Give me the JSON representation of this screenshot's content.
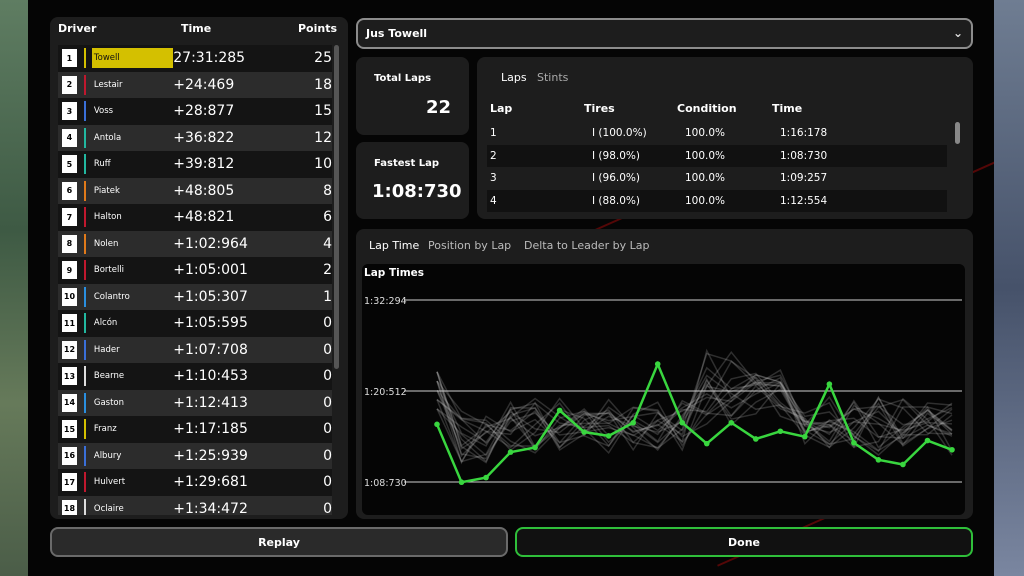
{
  "standings": {
    "headers": {
      "driver": "Driver",
      "time": "Time",
      "points": "Points"
    },
    "rows": [
      {
        "pos": "1",
        "name": "Towell",
        "time": "27:31:285",
        "points": "25",
        "color": "#d4c000",
        "highlight": true
      },
      {
        "pos": "2",
        "name": "Lestair",
        "time": "+24:469",
        "points": "18",
        "color": "#c0182e"
      },
      {
        "pos": "3",
        "name": "Voss",
        "time": "+28:877",
        "points": "15",
        "color": "#3a6fd8"
      },
      {
        "pos": "4",
        "name": "Antola",
        "time": "+36:822",
        "points": "12",
        "color": "#22b8a0"
      },
      {
        "pos": "5",
        "name": "Ruff",
        "time": "+39:812",
        "points": "10",
        "color": "#22b8a0"
      },
      {
        "pos": "6",
        "name": "Piatek",
        "time": "+48:805",
        "points": "8",
        "color": "#e07a1a"
      },
      {
        "pos": "7",
        "name": "Halton",
        "time": "+48:821",
        "points": "6",
        "color": "#c0182e"
      },
      {
        "pos": "8",
        "name": "Nolen",
        "time": "+1:02:964",
        "points": "4",
        "color": "#e07a1a"
      },
      {
        "pos": "9",
        "name": "Bortelli",
        "time": "+1:05:001",
        "points": "2",
        "color": "#c0182e"
      },
      {
        "pos": "10",
        "name": "Colantro",
        "time": "+1:05:307",
        "points": "1",
        "color": "#2a8fe0"
      },
      {
        "pos": "11",
        "name": "Alcón",
        "time": "+1:05:595",
        "points": "0",
        "color": "#22b8a0"
      },
      {
        "pos": "12",
        "name": "Hader",
        "time": "+1:07:708",
        "points": "0",
        "color": "#3a6fd8"
      },
      {
        "pos": "13",
        "name": "Bearne",
        "time": "+1:10:453",
        "points": "0",
        "color": "#dddddd"
      },
      {
        "pos": "14",
        "name": "Gaston",
        "time": "+1:12:413",
        "points": "0",
        "color": "#2a8fe0"
      },
      {
        "pos": "15",
        "name": "Franz",
        "time": "+1:17:185",
        "points": "0",
        "color": "#d4c000"
      },
      {
        "pos": "16",
        "name": "Albury",
        "time": "+1:25:939",
        "points": "0",
        "color": "#3a6fd8"
      },
      {
        "pos": "17",
        "name": "Hulvert",
        "time": "+1:29:681",
        "points": "0",
        "color": "#c0182e"
      },
      {
        "pos": "18",
        "name": "Oclaire",
        "time": "+1:34:472",
        "points": "0",
        "color": "#dddddd"
      }
    ]
  },
  "selected_driver": "Jus Towell",
  "total_laps": {
    "label": "Total Laps",
    "value": "22"
  },
  "fastest_lap": {
    "label": "Fastest Lap",
    "value": "1:08:730"
  },
  "laps_table": {
    "tabs": [
      "Laps",
      "Stints"
    ],
    "headers": [
      "Lap",
      "Tires",
      "Condition",
      "Time"
    ],
    "rows": [
      {
        "lap": "1",
        "tires": "I (100.0%)",
        "condition": "100.0%",
        "time": "1:16:178"
      },
      {
        "lap": "2",
        "tires": "I (98.0%)",
        "condition": "100.0%",
        "time": "1:08:730"
      },
      {
        "lap": "3",
        "tires": "I (96.0%)",
        "condition": "100.0%",
        "time": "1:09:257"
      },
      {
        "lap": "4",
        "tires": "I (88.0%)",
        "condition": "100.0%",
        "time": "1:12:554"
      }
    ]
  },
  "chart_tabs": [
    "Lap Time",
    "Position by Lap",
    "Delta to Leader by Lap"
  ],
  "chart_data": {
    "type": "line",
    "title": "Lap Times",
    "y_tick_labels": [
      "1:32:294",
      "1:20:512",
      "1:08:730"
    ],
    "y_ticks_seconds": [
      92.294,
      80.512,
      68.73
    ],
    "ylim_seconds": [
      68.73,
      92.294
    ],
    "x": [
      1,
      2,
      3,
      4,
      5,
      6,
      7,
      8,
      9,
      10,
      11,
      12,
      13,
      14,
      15,
      16,
      17,
      18,
      19,
      20,
      21,
      22
    ],
    "series": [
      {
        "values_seconds": [
          76.2,
          68.7,
          69.3,
          72.6,
          73.2,
          78.0,
          75.2,
          74.7,
          76.4,
          84.0,
          76.4,
          73.7,
          76.4,
          74.3,
          75.3,
          74.6,
          81.4,
          73.8,
          71.6,
          71.0,
          74.1,
          72.9
        ],
        "color": "#39d63f"
      }
    ],
    "background_series_count": 17,
    "grid": true
  },
  "buttons": {
    "replay": "Replay",
    "done": "Done"
  },
  "colors": {
    "accent": "#39d63f",
    "highlight_row": "#d4c000"
  }
}
